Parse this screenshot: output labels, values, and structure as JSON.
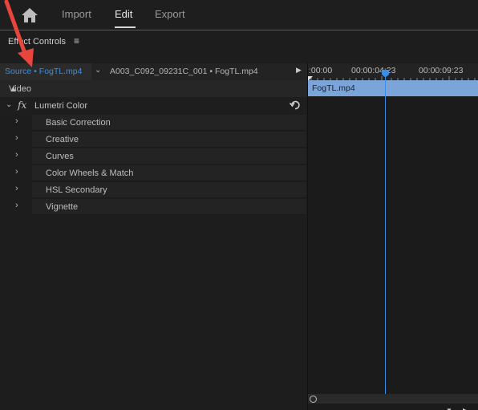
{
  "nav": {
    "tabs": [
      {
        "label": "Import"
      },
      {
        "label": "Edit"
      },
      {
        "label": "Export"
      }
    ]
  },
  "panel": {
    "title": "Effect Controls",
    "menu_glyph": "≡"
  },
  "tabs": {
    "source": "Source • FogTL.mp4",
    "sequence": "A003_C092_09231C_001 • FogTL.mp4"
  },
  "effects": {
    "section": "Video",
    "fx_symbol": "fx",
    "effect_name": "Lumetri Color",
    "sub_items": [
      {
        "label": "Basic Correction"
      },
      {
        "label": "Creative"
      },
      {
        "label": "Curves"
      },
      {
        "label": "Color Wheels & Match"
      },
      {
        "label": "HSL Secondary"
      },
      {
        "label": "Vignette"
      }
    ]
  },
  "timeline": {
    "timecodes": [
      ":00:00",
      "00:00:04:23",
      "00:00:09:23"
    ],
    "clip_name": "FogTL.mp4"
  },
  "colors": {
    "accent": "#3b8de6",
    "clip": "#7ba5d9",
    "annotation": "#e8453c"
  }
}
